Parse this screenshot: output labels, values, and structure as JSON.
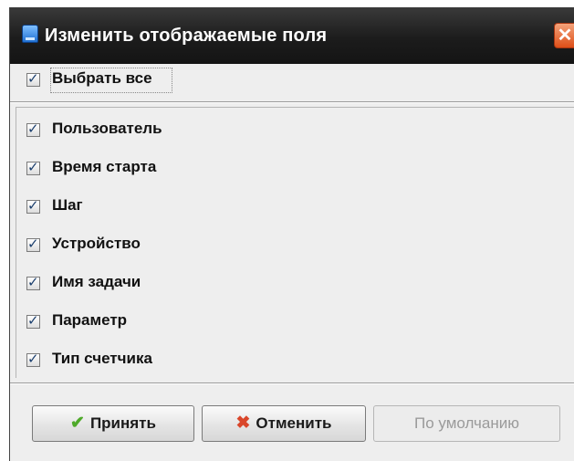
{
  "window": {
    "title": "Изменить отображаемые поля",
    "close_symbol": "✕"
  },
  "select_all": {
    "label": "Выбрать все",
    "checked": true
  },
  "fields": [
    {
      "label": "Пользователь",
      "checked": true
    },
    {
      "label": "Время старта",
      "checked": true
    },
    {
      "label": "Шаг",
      "checked": true
    },
    {
      "label": "Устройство",
      "checked": true
    },
    {
      "label": "Имя задачи",
      "checked": true
    },
    {
      "label": "Параметр",
      "checked": true
    },
    {
      "label": "Тип счетчика",
      "checked": true
    }
  ],
  "buttons": {
    "accept": {
      "label": "Принять",
      "icon": "checkmark-icon",
      "icon_glyph": "✔"
    },
    "cancel": {
      "label": "Отменить",
      "icon": "cross-icon",
      "icon_glyph": "✖"
    },
    "default": {
      "label": "По умолчанию",
      "enabled": false
    }
  },
  "colors": {
    "titlebar": "#1c1c1c",
    "close": "#de4f18",
    "accept_icon": "#4faa2a",
    "cancel_icon": "#d9462a"
  }
}
